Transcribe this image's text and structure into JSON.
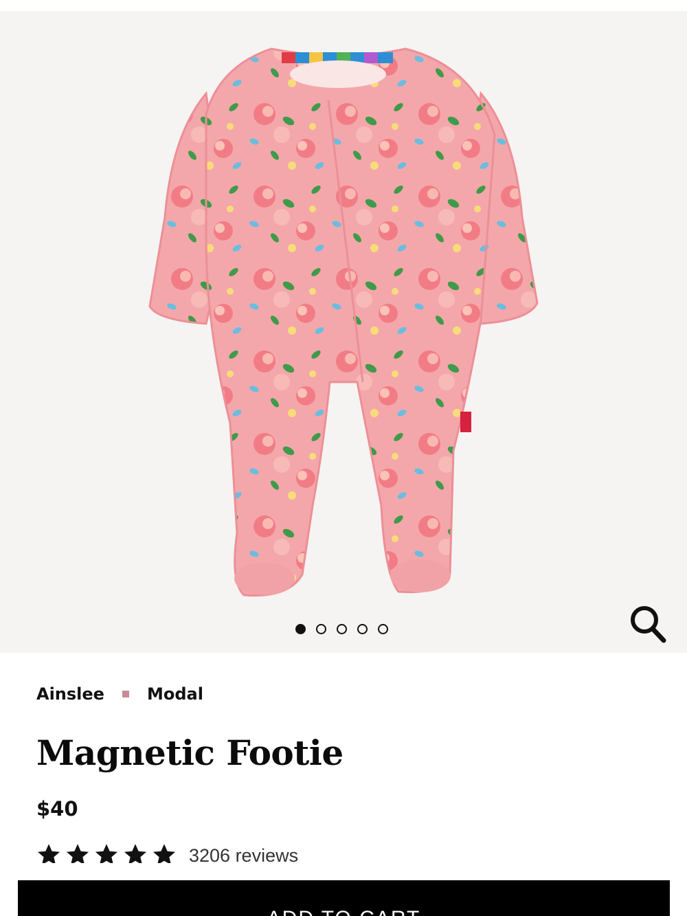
{
  "gallery": {
    "slide_count": 5,
    "active_slide": 1,
    "zoom_icon": "search-icon",
    "background": "#f5f4f2"
  },
  "product": {
    "color_name": "Ainslee",
    "fabric": "Modal",
    "title": "Magnetic Footie",
    "price": "$40",
    "rating": 5,
    "reviews": "3206 reviews"
  },
  "actions": {
    "add_to_cart": "ADD TO CART"
  },
  "colors": {
    "accent_separator": "#c98a96",
    "footie_pink": "#f4a7aa",
    "cart_button": "#000000"
  }
}
